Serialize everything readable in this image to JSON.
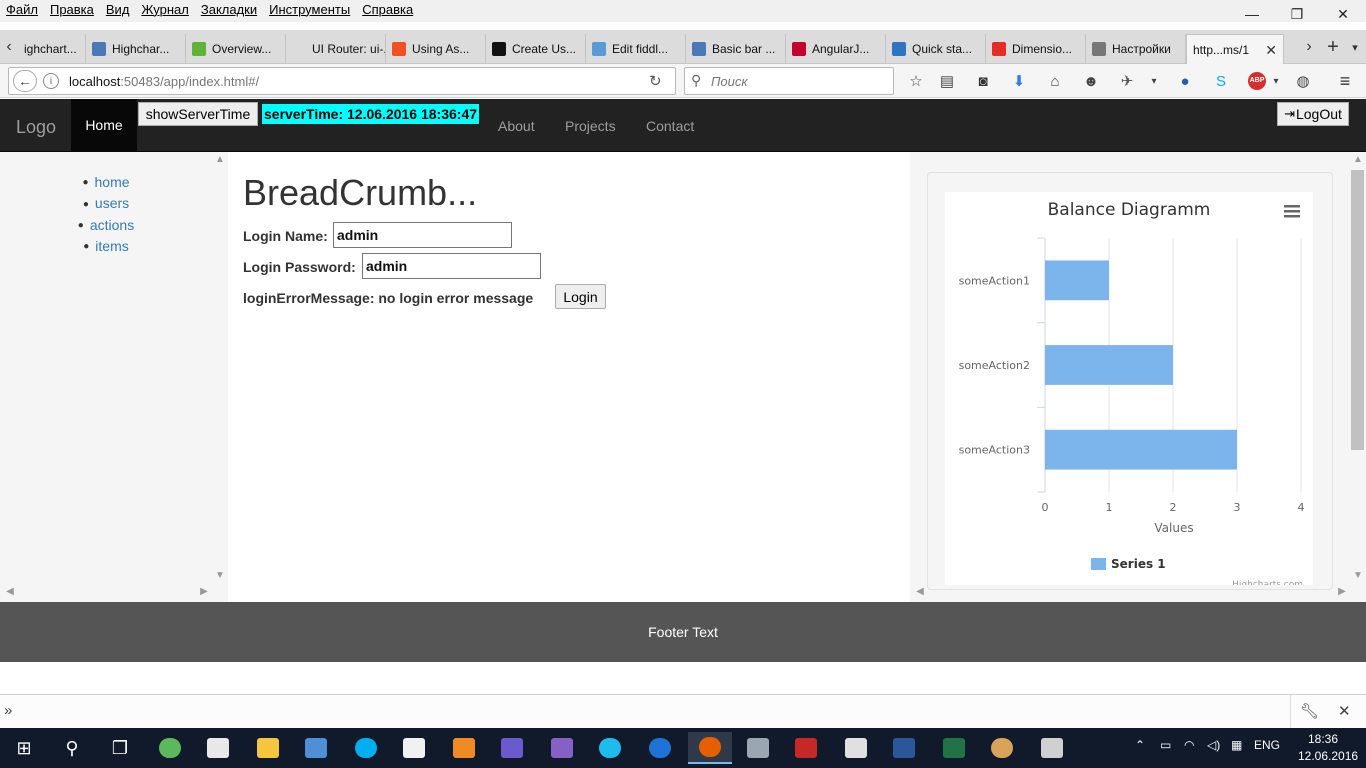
{
  "menubar": {
    "items": [
      "Файл",
      "Правка",
      "Вид",
      "Журнал",
      "Закладки",
      "Инструменты",
      "Справка"
    ]
  },
  "window_controls": {
    "minimize": "—",
    "restore": "❐",
    "close": "✕"
  },
  "tabs": [
    {
      "label": "ighchart...",
      "color": "#8a8a8a"
    },
    {
      "label": "Highchar...",
      "color": "#4a7ab5"
    },
    {
      "label": "Overview...",
      "color": "#5fb336"
    },
    {
      "label": "UI Router: ui-...",
      "color": "#dcdcdc"
    },
    {
      "label": "Using As...",
      "color": "#f25022"
    },
    {
      "label": "Create Us...",
      "color": "#111111"
    },
    {
      "label": "Edit fiddl...",
      "color": "#5b9bd5"
    },
    {
      "label": "Basic bar ...",
      "color": "#4a7ab5"
    },
    {
      "label": "AngularJ...",
      "color": "#c3002f"
    },
    {
      "label": "Quick sta...",
      "color": "#2f74c0"
    },
    {
      "label": "Dimensio...",
      "color": "#e52d27"
    },
    {
      "label": "Настройки",
      "color": "#777777"
    },
    {
      "label": "http...ms/1",
      "color": "#f5f5f5",
      "active": true
    }
  ],
  "tab_close": "✕",
  "new_tab": "+",
  "navbar": {
    "url_host": "localhost",
    "url_rest": ":50483/app/index.html#/",
    "search_placeholder": "Поиск"
  },
  "app": {
    "logo": "Logo",
    "home": "Home",
    "show_server_time": "showServerTime",
    "server_time": "serverTime: 12.06.2016 18:36:47",
    "nav": [
      "About",
      "Projects",
      "Contact"
    ],
    "logout": "LogOut"
  },
  "sidebar": {
    "items": [
      "home",
      "users",
      "actions",
      "items"
    ]
  },
  "main": {
    "breadcrumb": "BreadCrumb...",
    "login_name_label": "Login Name:",
    "login_name_value": "admin",
    "login_password_label": "Login Password:",
    "login_password_value": "admin",
    "error_message": "loginErrorMessage: no login error message",
    "login_button": "Login"
  },
  "chart_data": {
    "type": "bar",
    "title": "Balance Diagramm",
    "categories": [
      "someAction1",
      "someAction2",
      "someAction3"
    ],
    "series": [
      {
        "name": "Series 1",
        "values": [
          1,
          2,
          3
        ]
      }
    ],
    "xlabel": "Values",
    "xlim": [
      0,
      4
    ],
    "ticks": [
      0,
      1,
      2,
      3,
      4
    ],
    "bar_color": "#7cb5ec",
    "orientation": "horizontal",
    "legend": "bottom",
    "credits": "Highcharts.com"
  },
  "footer": {
    "text": "Footer Text"
  },
  "taskbar": {
    "lang": "ENG",
    "time": "18:36",
    "date": "12.06.2016"
  }
}
